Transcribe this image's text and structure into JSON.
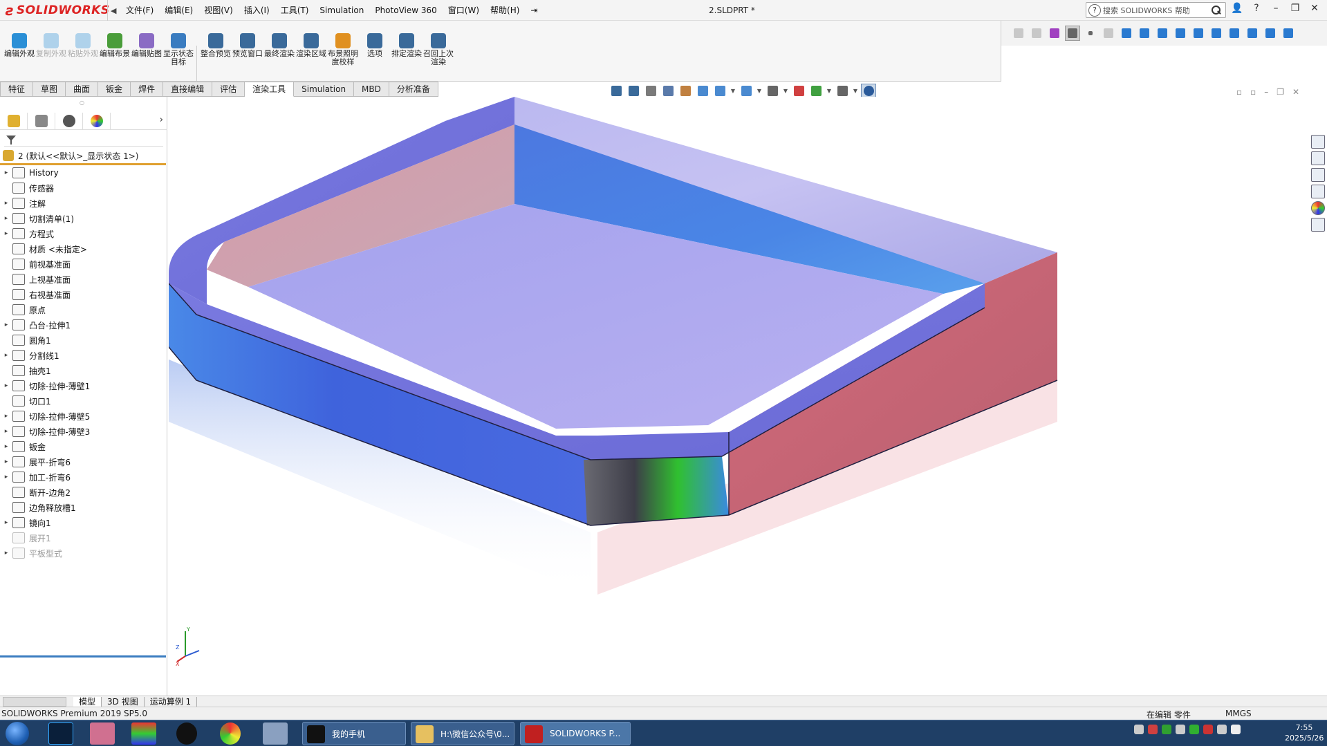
{
  "app": {
    "name": "SOLIDWORKS",
    "doc_title": "2.SLDPRT *",
    "help_search_placeholder": "搜索 SOLIDWORKS 帮助"
  },
  "menu": [
    "文件(F)",
    "编辑(E)",
    "视图(V)",
    "插入(I)",
    "工具(T)",
    "Simulation",
    "PhotoView 360",
    "窗口(W)",
    "帮助(H)"
  ],
  "commands": [
    {
      "label": "编辑外观",
      "color": "#2a8fd6",
      "enabled": true
    },
    {
      "label": "复制外观",
      "color": "#2a8fd6",
      "enabled": false
    },
    {
      "label": "粘贴外观",
      "color": "#2a8fd6",
      "enabled": false
    },
    {
      "label": "编辑布景",
      "color": "#4a9d3a",
      "enabled": true
    },
    {
      "label": "编辑贴图",
      "color": "#8a6bc4",
      "enabled": true
    },
    {
      "label": "显示状态目标",
      "color": "#3a7cc0",
      "enabled": true
    },
    {
      "label": "整合预览",
      "color": "#3a6a9a",
      "enabled": true
    },
    {
      "label": "预览窗口",
      "color": "#3a6a9a",
      "enabled": true
    },
    {
      "label": "最终渲染",
      "color": "#3a6a9a",
      "enabled": true
    },
    {
      "label": "渲染区域",
      "color": "#3a6a9a",
      "enabled": true
    },
    {
      "label": "布景照明度校样",
      "color": "#e09020",
      "enabled": true
    },
    {
      "label": "选项",
      "color": "#3a6a9a",
      "enabled": true
    },
    {
      "label": "排定渲染",
      "color": "#3a6a9a",
      "enabled": true
    },
    {
      "label": "召回上次渲染",
      "color": "#3a6a9a",
      "enabled": true
    }
  ],
  "tabs": [
    "特征",
    "草图",
    "曲面",
    "钣金",
    "焊件",
    "直接编辑",
    "评估",
    "渲染工具",
    "Simulation",
    "MBD",
    "分析准备"
  ],
  "active_tab": "渲染工具",
  "tree": {
    "root": "2 (默认<<默认>_显示状态 1>)",
    "nodes": [
      {
        "label": "History",
        "expandable": true,
        "icon": "history-icon"
      },
      {
        "label": "传感器",
        "expandable": false,
        "icon": "sensor-icon"
      },
      {
        "label": "注解",
        "expandable": true,
        "icon": "annotation-icon"
      },
      {
        "label": "切割清单(1)",
        "expandable": true,
        "icon": "cutlist-icon"
      },
      {
        "label": "方程式",
        "expandable": true,
        "icon": "equation-icon"
      },
      {
        "label": "材质 <未指定>",
        "expandable": false,
        "icon": "material-icon"
      },
      {
        "label": "前视基准面",
        "expandable": false,
        "icon": "plane-icon"
      },
      {
        "label": "上视基准面",
        "expandable": false,
        "icon": "plane-icon"
      },
      {
        "label": "右视基准面",
        "expandable": false,
        "icon": "plane-icon"
      },
      {
        "label": "原点",
        "expandable": false,
        "icon": "origin-icon"
      },
      {
        "label": "凸台-拉伸1",
        "expandable": true,
        "icon": "extrude-icon"
      },
      {
        "label": "圆角1",
        "expandable": false,
        "icon": "fillet-icon"
      },
      {
        "label": "分割线1",
        "expandable": true,
        "icon": "splitline-icon"
      },
      {
        "label": "抽壳1",
        "expandable": false,
        "icon": "shell-icon"
      },
      {
        "label": "切除-拉伸-薄壁1",
        "expandable": true,
        "icon": "cut-icon"
      },
      {
        "label": "切口1",
        "expandable": false,
        "icon": "rip-icon"
      },
      {
        "label": "切除-拉伸-薄壁5",
        "expandable": true,
        "icon": "cut-icon"
      },
      {
        "label": "切除-拉伸-薄壁3",
        "expandable": true,
        "icon": "cut-icon"
      },
      {
        "label": "钣金",
        "expandable": true,
        "icon": "sheetmetal-icon"
      },
      {
        "label": "展平-折弯6",
        "expandable": true,
        "icon": "unfold-icon"
      },
      {
        "label": "加工-折弯6",
        "expandable": true,
        "icon": "fold-icon"
      },
      {
        "label": "断开-边角2",
        "expandable": false,
        "icon": "breakcorner-icon"
      },
      {
        "label": "边角释放槽1",
        "expandable": false,
        "icon": "cornerrelief-icon"
      },
      {
        "label": "镜向1",
        "expandable": true,
        "icon": "mirror-icon"
      },
      {
        "label": "展开1",
        "expandable": false,
        "icon": "flatten-icon",
        "suppressed": true
      },
      {
        "label": "平板型式",
        "expandable": true,
        "icon": "flatpattern-icon",
        "suppressed": true
      }
    ]
  },
  "bottom_tabs": [
    "模型",
    "3D 视图",
    "运动算例 1"
  ],
  "status": {
    "product": "SOLIDWORKS Premium 2019 SP5.0",
    "mode": "在编辑 零件",
    "units": "MMGS"
  },
  "taskbar": {
    "tasks": [
      "我的手机",
      "H:\\微信公众号\\0...",
      "SOLIDWORKS P..."
    ],
    "time": "7:55",
    "date": "2025/5/26"
  },
  "colors": {
    "accent_orange": "#e0a030",
    "accent_blue": "#3a7cc0",
    "taskbar": "#1f3f66",
    "logo_red": "#d22222"
  }
}
